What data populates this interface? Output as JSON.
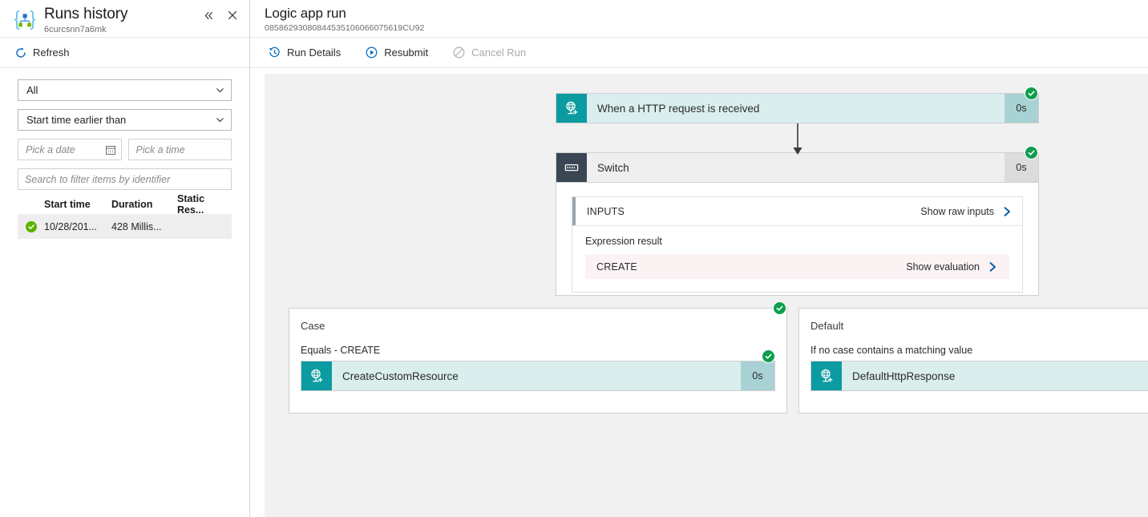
{
  "left_panel": {
    "title": "Runs history",
    "subtitle": "6curcsnn7a6mk",
    "logo_icon": "logic-apps-icon",
    "collapse_icon": "chevron-double-left-icon",
    "close_icon": "close-icon",
    "toolbar": {
      "refresh_label": "Refresh",
      "refresh_icon": "refresh-icon"
    },
    "filters": {
      "status_value": "All",
      "status_chevron_icon": "chevron-down-icon",
      "timefilter_value": "Start time earlier than",
      "timefilter_chevron_icon": "chevron-down-icon",
      "date_placeholder": "Pick a date",
      "date_icon": "calendar-icon",
      "time_placeholder": "Pick a time",
      "search_placeholder": "Search to filter items by identifier"
    },
    "table": {
      "columns": [
        "Start time",
        "Duration",
        "Static Res..."
      ],
      "rows": [
        {
          "status_icon": "success-check-icon",
          "start_time": "10/28/201...",
          "duration": "428 Millis...",
          "static_result": ""
        }
      ]
    }
  },
  "right_panel": {
    "title": "Logic app run",
    "run_id": "08586293080844535106066075619CU92",
    "toolbar": [
      {
        "label": "Run Details",
        "icon": "history-clock-icon",
        "disabled": false
      },
      {
        "label": "Resubmit",
        "icon": "play-circle-icon",
        "disabled": false
      },
      {
        "label": "Cancel Run",
        "icon": "cancel-circle-icon",
        "disabled": true
      }
    ]
  },
  "flow": {
    "trigger": {
      "label": "When a HTTP request is received",
      "duration": "0s",
      "icon": "http-request-globe-icon",
      "status_icon": "success-check-icon"
    },
    "switch": {
      "label": "Switch",
      "duration": "0s",
      "icon": "switch-icon",
      "status_icon": "success-check-icon",
      "inputs": {
        "header": "INPUTS",
        "show_raw_inputs": "Show raw inputs",
        "raw_inputs_arrow_icon": "chevron-right-icon",
        "expression_result_label": "Expression result",
        "expression_value": "CREATE",
        "show_evaluation": "Show evaluation",
        "evaluation_arrow_icon": "chevron-right-icon"
      }
    },
    "case": {
      "title": "Case",
      "condition": "Equals - CREATE",
      "status_icon": "success-check-icon",
      "action": {
        "label": "CreateCustomResource",
        "duration": "0s",
        "icon": "http-request-globe-icon",
        "status_icon": "success-check-icon"
      }
    },
    "default": {
      "title": "Default",
      "condition": "If no case contains a matching value",
      "action": {
        "label": "DefaultHttpResponse",
        "icon": "http-request-globe-icon"
      }
    }
  },
  "colors": {
    "teal_accent": "#0b9ba1",
    "node_fill": "#daeeee",
    "node_duration_fill": "#a9d2d4",
    "switch_icon_dark": "#3b4654",
    "success_green": "#0e9e4e",
    "canvas_bg": "#f1f1f1",
    "expression_row_bg": "#fbf3f3",
    "link_blue": "#0a5fa8"
  }
}
